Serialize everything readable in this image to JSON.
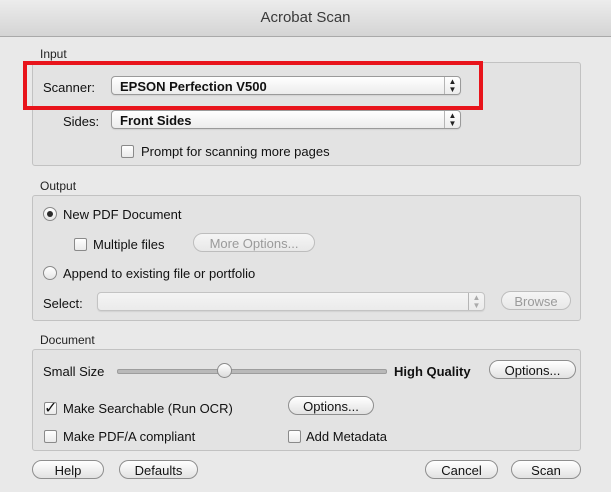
{
  "window": {
    "title": "Acrobat Scan"
  },
  "input": {
    "group_label": "Input",
    "scanner_label": "Scanner:",
    "scanner_value": "EPSON Perfection V500",
    "sides_label": "Sides:",
    "sides_value": "Front Sides",
    "prompt_more_pages": {
      "label": "Prompt for scanning more pages",
      "checked": false
    }
  },
  "output": {
    "group_label": "Output",
    "new_pdf": {
      "label": "New PDF Document",
      "selected": true
    },
    "multiple_files": {
      "label": "Multiple files",
      "checked": false
    },
    "more_options_label": "More Options...",
    "append": {
      "label": "Append to existing file or portfolio",
      "selected": false
    },
    "select_label": "Select:",
    "select_value": "",
    "browse_label": "Browse"
  },
  "document": {
    "group_label": "Document",
    "small_size_label": "Small Size",
    "high_quality_label": "High Quality",
    "quality_slider_fraction": 0.4,
    "quality_options_label": "Options...",
    "make_searchable": {
      "label": "Make Searchable (Run OCR)",
      "checked": true
    },
    "ocr_options_label": "Options...",
    "pdfa": {
      "label": "Make PDF/A compliant",
      "checked": false
    },
    "add_metadata": {
      "label": "Add Metadata",
      "checked": false
    }
  },
  "footer": {
    "help_label": "Help",
    "defaults_label": "Defaults",
    "cancel_label": "Cancel",
    "scan_label": "Scan"
  },
  "colors": {
    "highlight": "#e8141b"
  },
  "icons": {
    "popup_arrows": "up-down-arrows-icon",
    "checkmark": "checkmark-icon"
  }
}
